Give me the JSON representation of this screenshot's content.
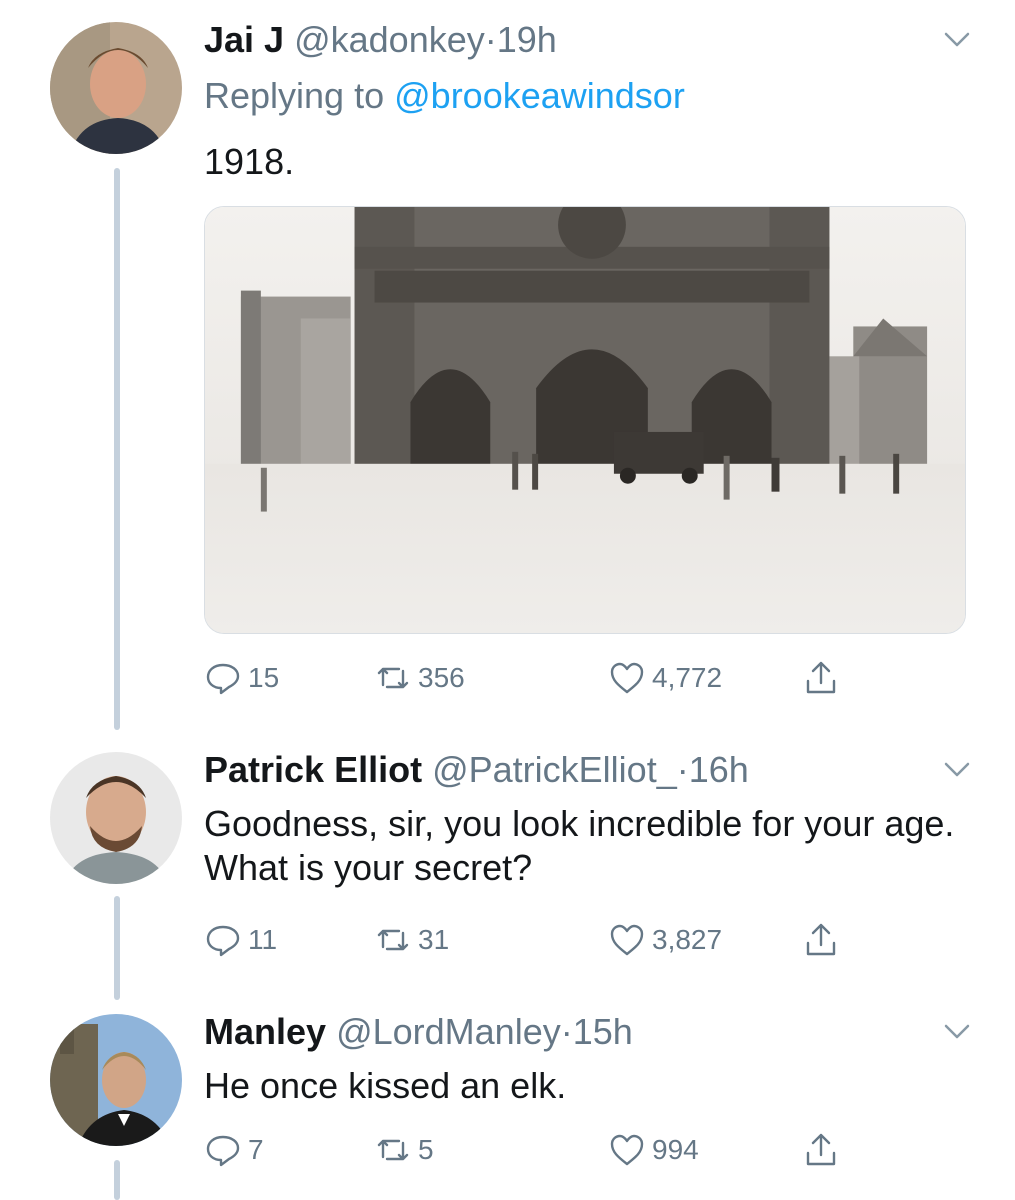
{
  "colors": {
    "accent": "#1da1f2",
    "muted": "#657786",
    "thread_line": "#c4d0dc"
  },
  "tweets": [
    {
      "name": "Jai J",
      "handle": "@kadonkey",
      "separator": "·",
      "time": "19h",
      "replying_prefix": "Replying to",
      "replying_handle": "@brookeawindsor",
      "text": "1918.",
      "photo": "Notre-Dame cathedral sepia photograph",
      "stats": {
        "replies": "15",
        "retweets": "356",
        "likes": "4,772"
      }
    },
    {
      "name": "Patrick Elliot",
      "handle": "@PatrickElliot_",
      "separator": "·",
      "time": "16h",
      "text": "Goodness, sir, you look incredible for your age. What is your secret?",
      "stats": {
        "replies": "11",
        "retweets": "31",
        "likes": "3,827"
      }
    },
    {
      "name": "Manley",
      "handle": "@LordManley",
      "separator": "·",
      "time": "15h",
      "text": "He once kissed an elk.",
      "stats": {
        "replies": "7",
        "retweets": "5",
        "likes": "994"
      }
    }
  ],
  "icons": {
    "reply": "reply-icon",
    "retweet": "retweet-icon",
    "like": "heart-icon",
    "share": "share-icon",
    "menu": "chevron-down-icon"
  }
}
